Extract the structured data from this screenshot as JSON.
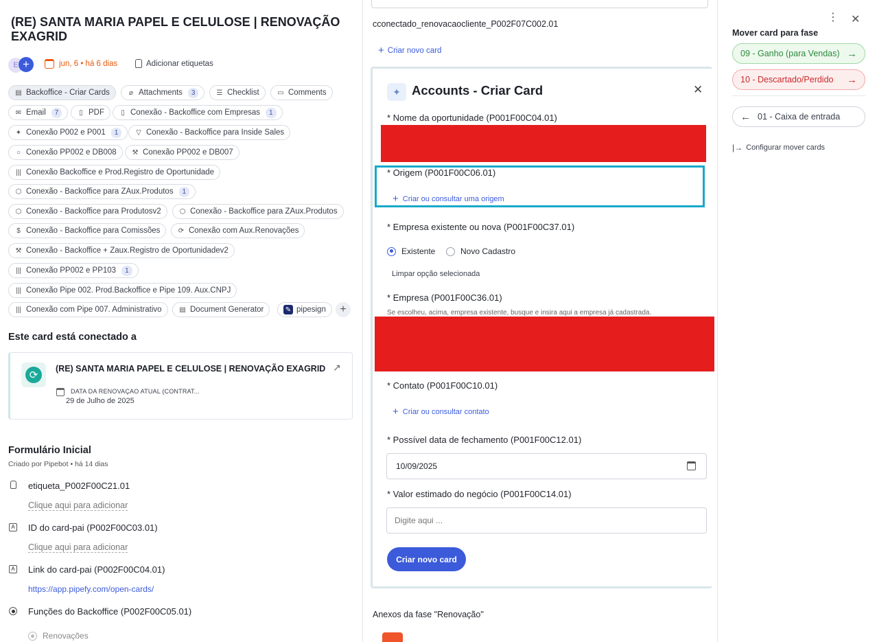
{
  "left": {
    "title": "(RE) SANTA MARIA PAPEL E CELULOSE | RENOVAÇÃO EXAGRID",
    "meta": {
      "date": "jun, 6 • há 6 dias",
      "add_tags": "Adicionar etiquetas"
    },
    "chips": [
      {
        "label": "Backoffice - Criar Cards",
        "icon": "form-icon"
      },
      {
        "label": "Attachments",
        "icon": "paperclip-icon",
        "badge": "3"
      },
      {
        "label": "Checklist",
        "icon": "checklist-icon"
      },
      {
        "label": "Comments",
        "icon": "comment-icon"
      },
      {
        "label": "Email",
        "icon": "mail-icon",
        "badge": "7"
      },
      {
        "label": "PDF",
        "icon": "pdf-icon"
      },
      {
        "label": "Conexão - Backoffice com Empresas",
        "icon": "database-icon",
        "badge": "1"
      },
      {
        "label": "Conexão P002 e P001",
        "icon": "handshake-icon",
        "badge": "1"
      },
      {
        "label": "Conexão - Backoffice para Inside Sales",
        "icon": "filter-icon"
      },
      {
        "label": "Conexão PP002 e DB008",
        "icon": "search-icon"
      },
      {
        "label": "Conexão PP002 e DB007",
        "icon": "hammer-icon"
      },
      {
        "label": "Conexão Backoffice e Prod.Registro de Oportunidade",
        "icon": "barcode-icon"
      },
      {
        "label": "Conexão - Backoffice para ZAux.Produtos",
        "icon": "cube-icon",
        "badge": "1"
      },
      {
        "label": "Conexão - Backoffice para Produtosv2",
        "icon": "cube-icon"
      },
      {
        "label": "Conexão - Backoffice para ZAux.Produtos",
        "icon": "cube-icon"
      },
      {
        "label": "Conexão - Backoffice para Comissões",
        "icon": "money-icon"
      },
      {
        "label": "Conexão com Aux.Renovações",
        "icon": "refresh-icon"
      },
      {
        "label": "Conexão - Backoffice + Zaux.Registro de Oportunidadev2",
        "icon": "hammer-icon"
      },
      {
        "label": "Conexão PP002 e PP103",
        "icon": "barcode-icon",
        "badge": "1"
      },
      {
        "label": "Conexão Pipe 002. Prod.Backoffice e Pipe 109. Aux.CNPJ",
        "icon": "barcode-icon"
      },
      {
        "label": "Conexão com Pipe 007. Administrativo",
        "icon": "barcode-icon"
      },
      {
        "label": "Document Generator",
        "icon": "document-icon"
      },
      {
        "label": "pipesign",
        "icon": "pipesign-icon"
      }
    ],
    "connected_heading": "Este card está conectado a",
    "connected_card": {
      "title": "(RE) SANTA MARIA PAPEL E CELULOSE | RENOVAÇÃO EXAGRID",
      "field_label": "DATA DA RENOVAÇAO ATUAL (CONTRAT...",
      "field_value": "29 de Julho de 2025"
    },
    "form": {
      "heading": "Formulário Inicial",
      "created": "Criado por Pipebot • há 14 dias",
      "fields": [
        {
          "label": "etiqueta_P002F00C21.01",
          "value": "Clique aqui para adicionar"
        },
        {
          "label": "ID do card-pai (P002F00C03.01)",
          "value": "Clique aqui para adicionar"
        },
        {
          "label": "Link do card-pai (P002F00C04.01)",
          "value": "https://app.pipefy.com/open-cards/"
        },
        {
          "label": "Funções do Backoffice (P002F00C05.01)",
          "value": "Renovações"
        }
      ]
    }
  },
  "middle": {
    "connection_name": "cconectado_renovacaocliente_P002F07C002.01",
    "create_new_card": "Criar novo card",
    "modal": {
      "title": "Accounts - Criar Card",
      "f1_label": "* Nome da oportunidade (P001F00C04.01)",
      "f2_label": "* Origem (P001F00C06.01)",
      "f2_link": "Criar ou consultar uma origem",
      "f3_label": "* Empresa existente ou nova (P001F00C37.01)",
      "f3_opt1": "Existente",
      "f3_opt2": "Novo Cadastro",
      "f3_clear": "Limpar opção selecionada",
      "f4_label": "* Empresa (P001F00C36.01)",
      "f4_help": "Se escolheu, acima, empresa existente, busque e insira aqui a empresa já cadastrada.",
      "f5_label": "* Contato (P001F00C10.01)",
      "f5_link": "Criar ou consultar contato",
      "f6_label": "* Possível data de fechamento (P001F00C12.01)",
      "f6_value": "10/09/2025",
      "f7_label": "* Valor estimado do negócio (P001F00C14.01)",
      "f7_placeholder": "Digite aqui ...",
      "submit": "Criar novo card"
    },
    "attachments_heading": "Anexos da fase \"Renovação\""
  },
  "right": {
    "move_heading": "Mover card para fase",
    "phase_won": "09 - Ganho (para Vendas)",
    "phase_lost": "10 - Descartado/Perdido",
    "phase_inbox": "01 - Caixa de entrada",
    "configure": "Configurar mover cards"
  },
  "colors": {
    "accent": "#3b5bdb",
    "highlight": "#17a9c9",
    "redacted": "#e51d1d",
    "won_bg": "#eef9ee",
    "lost_bg": "#fdeeee"
  }
}
